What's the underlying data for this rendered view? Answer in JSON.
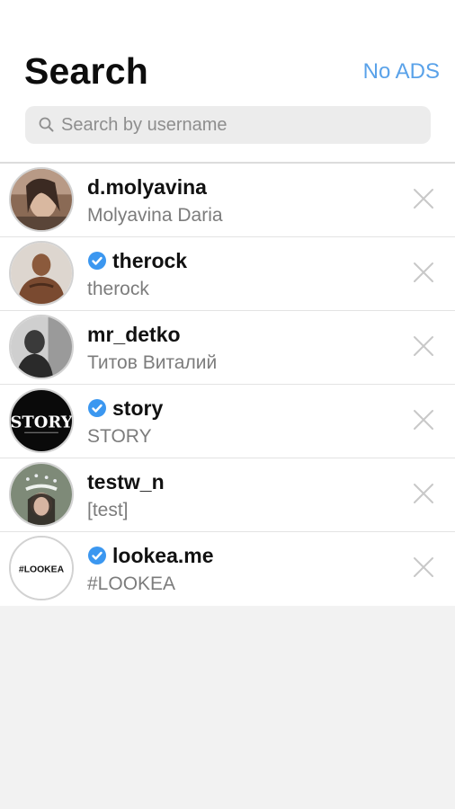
{
  "header": {
    "title": "Search",
    "no_ads_label": "No ADS"
  },
  "search": {
    "placeholder": "Search by username",
    "value": ""
  },
  "results": [
    {
      "username": "d.molyavina",
      "full_name": "Molyavina Daria",
      "verified": false,
      "avatar": "photo"
    },
    {
      "username": "therock",
      "full_name": "therock",
      "verified": true,
      "avatar": "photo"
    },
    {
      "username": "mr_detko",
      "full_name": "Титов Виталий",
      "verified": false,
      "avatar": "photo"
    },
    {
      "username": "story",
      "full_name": "STORY",
      "verified": true,
      "avatar": "logo",
      "avatar_logo_text": "STORY"
    },
    {
      "username": "testw_n",
      "full_name": "[test]",
      "verified": false,
      "avatar": "photo"
    },
    {
      "username": "lookea.me",
      "full_name": "#LOOKEA",
      "verified": true,
      "avatar": "logo",
      "avatar_logo_text": "#LOOKEA"
    }
  ],
  "colors": {
    "accent": "#5aa2e9",
    "verified": "#3b97f0",
    "background": "#f2f2f2"
  },
  "icons": {
    "search": "search-icon",
    "verified": "verified-badge-icon",
    "remove": "close-icon"
  }
}
